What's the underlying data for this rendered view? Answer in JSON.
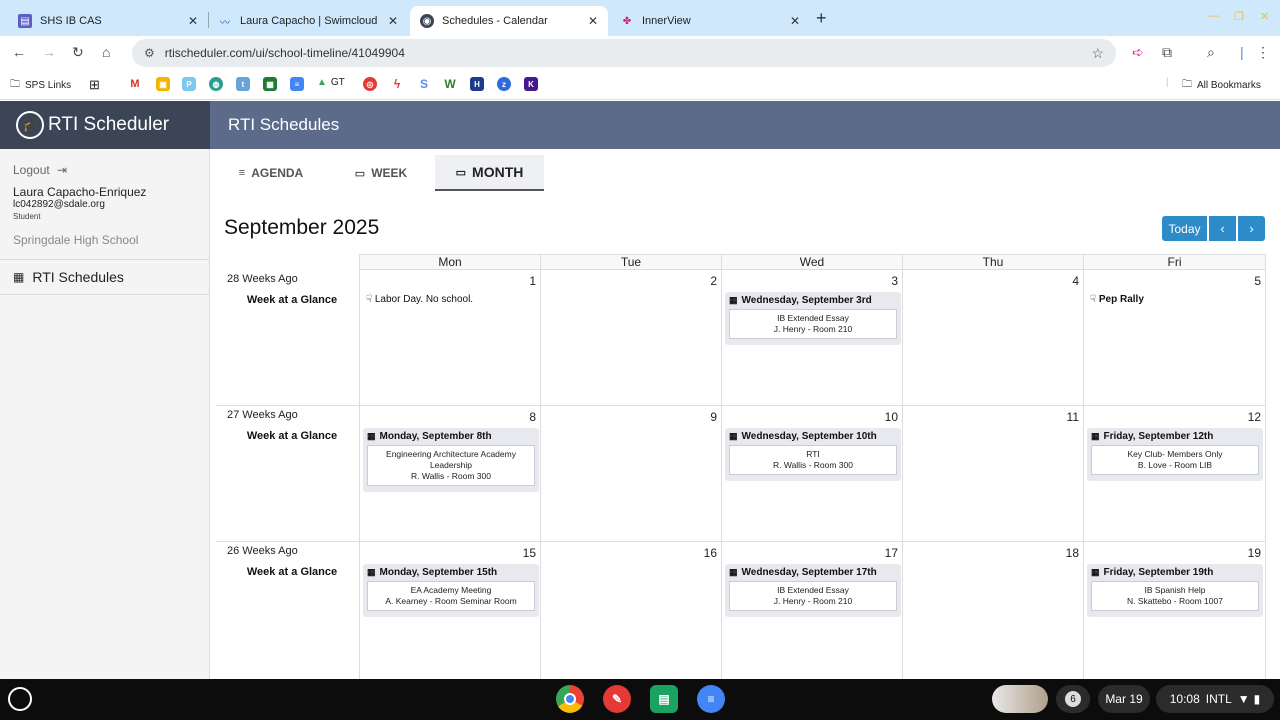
{
  "browser": {
    "tabs": [
      {
        "title": "SHS IB CAS",
        "icon": "forms-icon"
      },
      {
        "title": "Laura Capacho | Swimcloud",
        "icon": "swimcloud-icon"
      },
      {
        "title": "Schedules - Calendar",
        "icon": "rti-icon"
      },
      {
        "title": "InnerView",
        "icon": "innerview-icon"
      }
    ],
    "url": "rtischeduler.com/ui/school-timeline/41049904",
    "bookmarks": {
      "sps_links": "SPS Links",
      "gt": "GT",
      "all_bookmarks": "All Bookmarks"
    }
  },
  "app": {
    "brand": "RTI Scheduler",
    "header_title": "RTI Schedules"
  },
  "sidebar": {
    "logout": "Logout",
    "user_name": "Laura Capacho-Enriquez",
    "user_email": "lc042892@sdale.org",
    "user_role": "Student",
    "school": "Springdale High School",
    "nav_item": "RTI Schedules"
  },
  "view_tabs": {
    "agenda": "AGENDA",
    "week": "WEEK",
    "month": "MONTH"
  },
  "calendar": {
    "title": "September 2025",
    "today_label": "Today",
    "prev_label": "‹",
    "next_label": "›",
    "days": [
      "Mon",
      "Tue",
      "Wed",
      "Thu",
      "Fri"
    ],
    "week_at_a_glance": "Week at a Glance",
    "weeks": [
      {
        "label": "28 Weeks Ago",
        "days": [
          {
            "num": "1",
            "holiday": "Labor Day. No school."
          },
          {
            "num": "2"
          },
          {
            "num": "3",
            "event": {
              "header": "Wednesday, September 3rd",
              "title": "IB Extended Essay",
              "detail": "J. Henry - Room 210"
            }
          },
          {
            "num": "4"
          },
          {
            "num": "5",
            "holiday": "Pep Rally"
          }
        ]
      },
      {
        "label": "27 Weeks Ago",
        "days": [
          {
            "num": "8",
            "event": {
              "header": "Monday, September 8th",
              "title": "Engineering Architecture Academy Leadership",
              "detail": "R. Wallis - Room 300"
            }
          },
          {
            "num": "9"
          },
          {
            "num": "10",
            "event": {
              "header": "Wednesday, September 10th",
              "title": "RTI",
              "detail": "R. Wallis - Room 300"
            }
          },
          {
            "num": "11"
          },
          {
            "num": "12",
            "event": {
              "header": "Friday, September 12th",
              "title": "Key Club- Members Only",
              "detail": "B. Love - Room LIB"
            }
          }
        ]
      },
      {
        "label": "26 Weeks Ago",
        "days": [
          {
            "num": "15",
            "event": {
              "header": "Monday, September 15th",
              "title": "EA Academy Meeting",
              "detail": "A. Kearney - Room Seminar Room"
            }
          },
          {
            "num": "16"
          },
          {
            "num": "17",
            "event": {
              "header": "Wednesday, September 17th",
              "title": "IB Extended Essay",
              "detail": "J. Henry - Room 210"
            }
          },
          {
            "num": "18"
          },
          {
            "num": "19",
            "event": {
              "header": "Friday, September 19th",
              "title": "IB Spanish Help",
              "detail": "N. Skattebo - Room 1007"
            }
          }
        ]
      }
    ]
  },
  "shelf": {
    "notification_count": "6",
    "date": "Mar 19",
    "time": "10:08",
    "input_method": "INTL"
  },
  "colors": {
    "brand_bg": "#3b4556",
    "header_bg": "#5d6b8a",
    "button_blue": "#2e8bc9",
    "tabstrip_bg": "#cfe8fb"
  }
}
